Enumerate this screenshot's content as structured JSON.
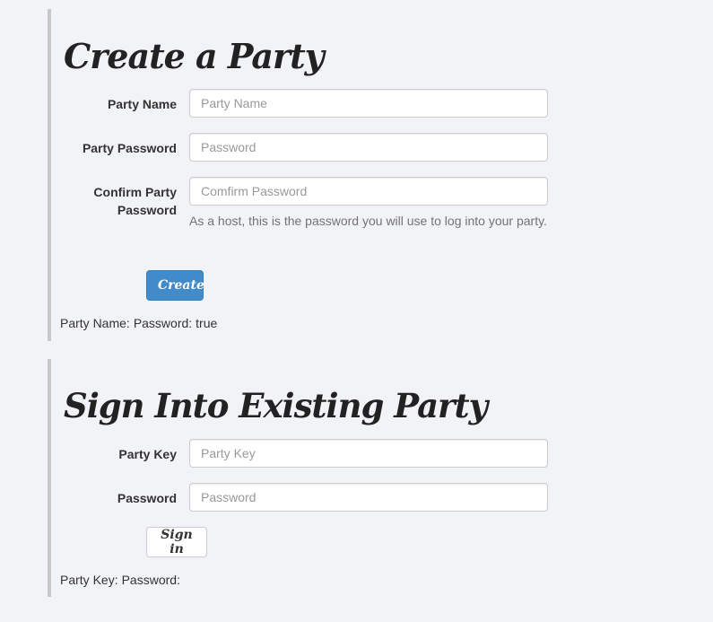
{
  "create_party": {
    "title": "Create a Party",
    "fields": {
      "name_label": "Party Name",
      "name_placeholder": "Party Name",
      "password_label": "Party Password",
      "password_placeholder": "Password",
      "confirm_label_line1": "Confirm Party",
      "confirm_label_line2": "Password",
      "confirm_placeholder": "Comfirm Password"
    },
    "help_text": "As a host, this is the password you will use to log into your party.",
    "button_label": "Create",
    "status": {
      "name_label": "Party Name:",
      "password_label": "Password:",
      "password_value": "true"
    }
  },
  "sign_in": {
    "title": "Sign Into Existing Party",
    "fields": {
      "key_label": "Party Key",
      "key_placeholder": "Party Key",
      "password_label": "Password",
      "password_placeholder": "Password"
    },
    "button_label": "Sign in",
    "status": {
      "key_label": "Party Key:",
      "password_label": "Password:"
    }
  }
}
